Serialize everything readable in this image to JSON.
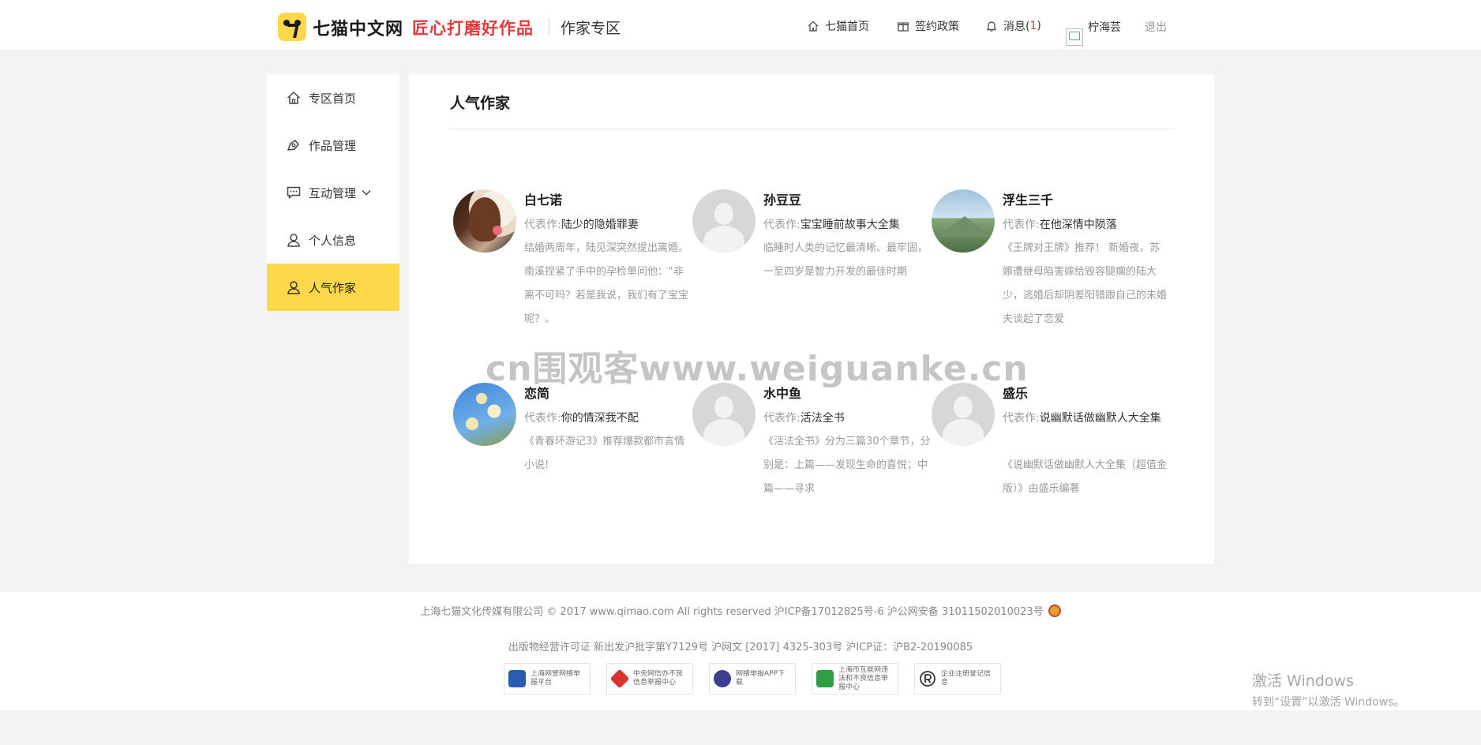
{
  "header": {
    "brand": "七猫中文网",
    "slogan": "匠心打磨好作品",
    "zone_title": "作家专区",
    "nav": {
      "home": "七猫首页",
      "contract": "签约政策",
      "messages": "消息(",
      "messages_count": "1",
      "messages_close": ")"
    },
    "username": "柠海芸",
    "logout": "退出"
  },
  "sidebar": {
    "items": [
      {
        "label": "专区首页",
        "icon": "home-icon"
      },
      {
        "label": "作品管理",
        "icon": "pen-icon"
      },
      {
        "label": "互动管理",
        "icon": "comment-icon"
      },
      {
        "label": "个人信息",
        "icon": "user-icon"
      },
      {
        "label": "人气作家",
        "icon": "user-icon",
        "active": true
      }
    ]
  },
  "main": {
    "title": "人气作家",
    "rep_label": "代表作:",
    "authors": [
      {
        "name": "白七诺",
        "work": "陆少的隐婚罪妻",
        "desc": "结婚两周年，陆见深突然提出离婚。南溪捏紧了手中的孕检单问他：“非离不可吗？若是我说，我们有了宝宝呢？。"
      },
      {
        "name": "孙豆豆",
        "work": "宝宝睡前故事大全集",
        "desc": "临睡时人类的记忆最清晰、最牢固，一至四岁是智力开发的最佳时期"
      },
      {
        "name": "浮生三千",
        "work": "在他深情中陨落",
        "desc": "《王牌对王牌》推荐！ 新婚夜，苏娜遭继母陷害嫁给毁容腿瘸的陆大少，逃婚后却阴差阳错跟自己的未婚夫谈起了恋爱"
      },
      {
        "name": "恋简",
        "work": "你的情深我不配",
        "desc": "《青春环游记3》推荐爆款都市言情小说!"
      },
      {
        "name": "水中鱼",
        "work": "活法全书",
        "desc": "《活法全书》分为三篇30个章节，分别是：上篇——发现生命的喜悦；中篇——寻求"
      },
      {
        "name": "盛乐",
        "work": "说幽默话做幽默人大全集",
        "desc": "《说幽默话做幽默人大全集（超值金版）》由盛乐编著"
      }
    ]
  },
  "footer": {
    "line1": "上海七猫文化传媒有限公司 © 2017 www.qimao.com All rights reserved 沪ICP备17012825号-6 沪公网安备 31011502010023号",
    "line2": "出版物经营许可证 新出发沪批字第Y7129号 沪网文 [2017] 4325-303号 沪ICP证：沪B2-20190085",
    "badges": [
      {
        "text": "上海网警网络举报平台",
        "color": "#2a5db0"
      },
      {
        "text": "中央网信办不良信息举报中心",
        "color": "#d8342c"
      },
      {
        "text": "网络举报APP下载",
        "color": "#3a3f8f"
      },
      {
        "text": "上海市互联网违法和不良信息举报中心",
        "color": "#2f9e44"
      },
      {
        "text": "企业注册登记信息",
        "color": "#333333"
      }
    ]
  },
  "overlays": {
    "watermark": "cn围观客www.weiguanke.cn",
    "windows_title": "激活 Windows",
    "windows_sub": "转到“设置”以激活 Windows。"
  },
  "colors": {
    "accent": "#ffd84a",
    "brand_red": "#e4393c"
  }
}
